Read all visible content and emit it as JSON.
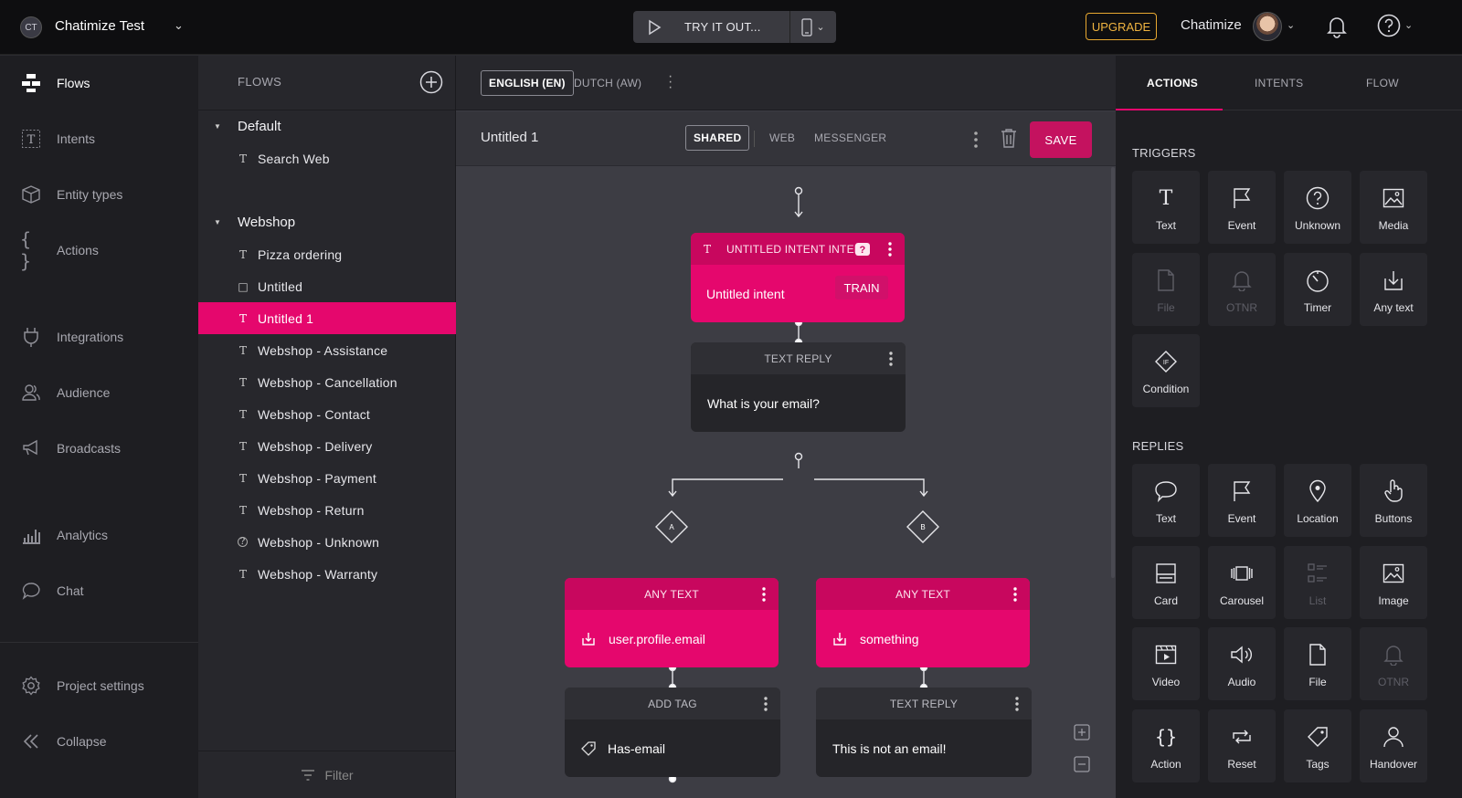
{
  "topbar": {
    "project_initials": "CT",
    "project_name": "Chatimize Test",
    "try_label": "TRY IT OUT...",
    "upgrade_label": "UPGRADE",
    "user_name": "Chatimize"
  },
  "nav": {
    "items": [
      {
        "label": "Flows",
        "icon": "flows-icon"
      },
      {
        "label": "Intents",
        "icon": "intents-icon"
      },
      {
        "label": "Entity types",
        "icon": "entity-types-icon"
      },
      {
        "label": "Actions",
        "icon": "actions-icon"
      },
      {
        "label": "Integrations",
        "icon": "integrations-icon"
      },
      {
        "label": "Audience",
        "icon": "audience-icon"
      },
      {
        "label": "Broadcasts",
        "icon": "broadcasts-icon"
      },
      {
        "label": "Analytics",
        "icon": "analytics-icon"
      },
      {
        "label": "Chat",
        "icon": "chat-icon"
      },
      {
        "label": "Project settings",
        "icon": "settings-icon"
      },
      {
        "label": "Collapse",
        "icon": "collapse-icon"
      }
    ]
  },
  "flows": {
    "title": "FLOWS",
    "filter_label": "Filter",
    "groups": [
      {
        "label": "Default"
      },
      {
        "label": "Webshop"
      }
    ],
    "items": [
      {
        "label": "Search Web",
        "icon": "T"
      },
      {
        "label": "Pizza ordering",
        "icon": "T"
      },
      {
        "label": "Untitled",
        "icon": "□"
      },
      {
        "label": "Untitled 1",
        "icon": "T"
      },
      {
        "label": "Webshop - Assistance",
        "icon": "T"
      },
      {
        "label": "Webshop - Cancellation",
        "icon": "T"
      },
      {
        "label": "Webshop - Contact",
        "icon": "T"
      },
      {
        "label": "Webshop - Delivery",
        "icon": "T"
      },
      {
        "label": "Webshop - Payment",
        "icon": "T"
      },
      {
        "label": "Webshop - Return",
        "icon": "T"
      },
      {
        "label": "Webshop - Unknown",
        "icon": "?"
      },
      {
        "label": "Webshop - Warranty",
        "icon": "T"
      }
    ]
  },
  "editor": {
    "languages": [
      "ENGLISH (EN)",
      "DUTCH (AW)"
    ],
    "flow_title": "Untitled 1",
    "channels": [
      "SHARED",
      "WEB",
      "MESSENGER"
    ],
    "save_label": "SAVE",
    "nodes": {
      "intent": {
        "header": "UNTITLED INTENT INTENT",
        "body": "Untitled intent",
        "train": "TRAIN"
      },
      "reply1": {
        "header": "TEXT REPLY",
        "body": "What is your email?"
      },
      "branch_a": "A",
      "branch_b": "B",
      "anytext_a": {
        "header": "ANY TEXT",
        "body": "user.profile.email"
      },
      "anytext_b": {
        "header": "ANY TEXT",
        "body": "something"
      },
      "addtag": {
        "header": "ADD TAG",
        "body": "Has-email"
      },
      "reply2": {
        "header": "TEXT REPLY",
        "body": "This is not an email!"
      }
    }
  },
  "rpanel": {
    "tabs": [
      "ACTIONS",
      "INTENTS",
      "FLOW"
    ],
    "triggers_label": "TRIGGERS",
    "replies_label": "REPLIES",
    "triggers": [
      {
        "label": "Text",
        "icon": "text-icon"
      },
      {
        "label": "Event",
        "icon": "flag-icon"
      },
      {
        "label": "Unknown",
        "icon": "question-icon"
      },
      {
        "label": "Media",
        "icon": "image-icon"
      },
      {
        "label": "File",
        "icon": "file-icon",
        "disabled": true
      },
      {
        "label": "OTNR",
        "icon": "bell-icon",
        "disabled": true
      },
      {
        "label": "Timer",
        "icon": "timer-icon"
      },
      {
        "label": "Any text",
        "icon": "download-icon"
      },
      {
        "label": "Condition",
        "icon": "condition-icon"
      }
    ],
    "replies": [
      {
        "label": "Text",
        "icon": "speech-bubble-icon"
      },
      {
        "label": "Event",
        "icon": "flag-icon"
      },
      {
        "label": "Location",
        "icon": "location-pin-icon"
      },
      {
        "label": "Buttons",
        "icon": "pointer-hand-icon"
      },
      {
        "label": "Card",
        "icon": "card-icon"
      },
      {
        "label": "Carousel",
        "icon": "carousel-icon"
      },
      {
        "label": "List",
        "icon": "list-icon",
        "disabled": true
      },
      {
        "label": "Image",
        "icon": "image-icon"
      },
      {
        "label": "Video",
        "icon": "video-icon"
      },
      {
        "label": "Audio",
        "icon": "audio-icon"
      },
      {
        "label": "File",
        "icon": "file-icon"
      },
      {
        "label": "OTNR",
        "icon": "bell-icon",
        "disabled": true
      },
      {
        "label": "Action",
        "icon": "braces-icon"
      },
      {
        "label": "Reset",
        "icon": "reset-icon"
      },
      {
        "label": "Tags",
        "icon": "tag-icon"
      },
      {
        "label": "Handover",
        "icon": "person-icon"
      }
    ]
  }
}
